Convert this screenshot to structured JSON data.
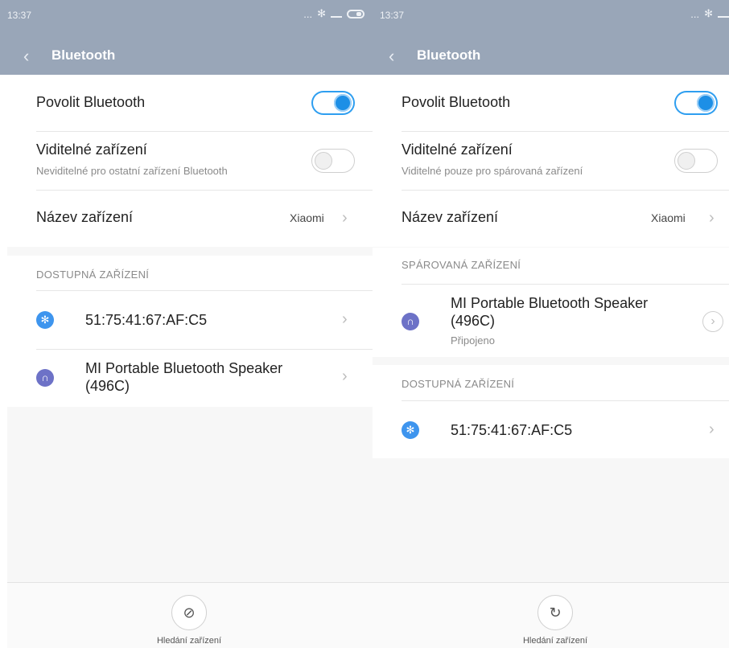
{
  "colors": {
    "header": "#99a6b8",
    "accent": "#2e9ef0",
    "bt_icon": "#3e95ee",
    "headphone_icon": "#6d72c7"
  },
  "left": {
    "status": {
      "time": "13:37",
      "dots": "...",
      "bt_symbol": "✻"
    },
    "title": "Bluetooth",
    "enable_label": "Povolit Bluetooth",
    "visible_label": "Viditelné zařízení",
    "visible_sub": "Neviditelné pro ostatní zařízení Bluetooth",
    "name_label": "Název zařízení",
    "name_value": "Xiaomi",
    "available_header": "DOSTUPNÁ ZAŘÍZENÍ",
    "devices": [
      {
        "name": "51:75:41:67:AF:C5",
        "icon": "bluetooth-icon"
      },
      {
        "name_line1": "MI Portable Bluetooth Speaker",
        "name_line2": "(496C)",
        "icon": "headphones-icon"
      }
    ],
    "search_label": "Hledání zařízení"
  },
  "right": {
    "status": {
      "time": "13:37",
      "dots": "...",
      "bt_symbol": "✻"
    },
    "title": "Bluetooth",
    "enable_label": "Povolit Bluetooth",
    "visible_label": "Viditelné zařízení",
    "visible_sub": "Viditelné pouze pro spárovaná zařízení",
    "name_label": "Název zařízení",
    "name_value": "Xiaomi",
    "paired_header": "SPÁROVANÁ ZAŘÍZENÍ",
    "paired": {
      "name_line1": "MI Portable Bluetooth Speaker",
      "name_line2": "(496C)",
      "status": "Připojeno",
      "icon": "headphones-icon"
    },
    "available_header": "DOSTUPNÁ ZAŘÍZENÍ",
    "devices": [
      {
        "name": "51:75:41:67:AF:C5",
        "icon": "bluetooth-icon"
      }
    ],
    "search_label": "Hledání zařízení"
  }
}
